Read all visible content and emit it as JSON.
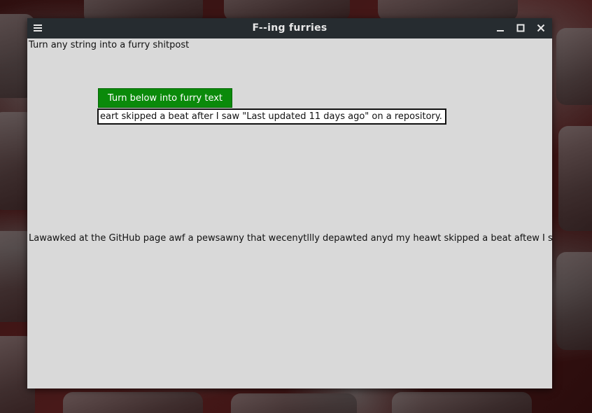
{
  "window": {
    "title": "F--ing furries"
  },
  "titlebar": {
    "menu_icon": "hamburger-menu-icon",
    "minimize_icon": "minimize-icon",
    "maximize_icon": "maximize-icon",
    "close_icon": "close-icon"
  },
  "main": {
    "subtitle": "Turn any string into a furry shitpost",
    "convert_button_label": "Turn below into furry text",
    "convert_button_color": "#0a8a0a",
    "input_value": "eart skipped a beat after I saw \"Last updated 11 days ago\" on a repository.",
    "output_text": "Lawawked at the GitHub page awf a pewsawny that wecenytllly depawted anyd my heawt skipped a beat aftew I s"
  }
}
